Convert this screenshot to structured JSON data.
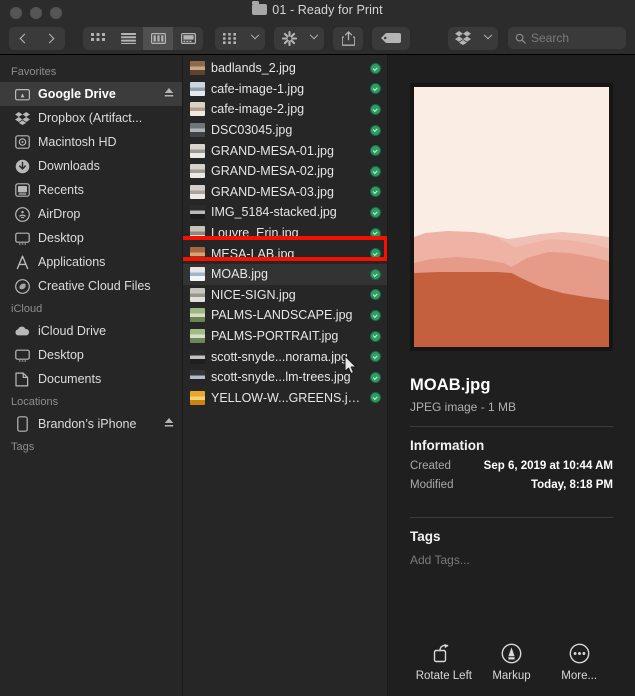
{
  "window": {
    "title": "01 - Ready for Print",
    "title_icon": "folder-icon",
    "traffic_lights": [
      "close-button",
      "minimize-button",
      "maximize-button"
    ]
  },
  "toolbar": {
    "back_icon": "chevron-left-icon",
    "forward_icon": "chevron-right-icon",
    "view_modes": [
      {
        "name": "icon-view",
        "icon": "grid-icon",
        "selected": false
      },
      {
        "name": "list-view",
        "icon": "list-icon",
        "selected": false
      },
      {
        "name": "column-view",
        "icon": "columns-icon",
        "selected": true
      },
      {
        "name": "gallery-view",
        "icon": "gallery-icon",
        "selected": false
      }
    ],
    "group_by_icon": "grid-group-icon",
    "action_icon": "gear-icon",
    "share_icon": "share-icon",
    "tag_icon": "tag-icon",
    "dropbox_icon": "dropbox-icon",
    "search": {
      "icon": "search-icon",
      "placeholder": "Search",
      "value": ""
    }
  },
  "sidebar": {
    "sections": [
      {
        "header": "Favorites",
        "items": [
          {
            "label": "Google Drive",
            "icon": "google-drive-icon",
            "selected": true,
            "eject": true
          },
          {
            "label": "Dropbox (Artifact...",
            "icon": "dropbox-icon",
            "selected": false,
            "eject": false
          },
          {
            "label": "Macintosh HD",
            "icon": "hard-drive-icon",
            "selected": false,
            "eject": false
          },
          {
            "label": "Downloads",
            "icon": "downloads-icon",
            "selected": false,
            "eject": false
          },
          {
            "label": "Recents",
            "icon": "recents-icon",
            "selected": false,
            "eject": false
          },
          {
            "label": "AirDrop",
            "icon": "airdrop-icon",
            "selected": false,
            "eject": false
          },
          {
            "label": "Desktop",
            "icon": "desktop-icon",
            "selected": false,
            "eject": false
          },
          {
            "label": "Applications",
            "icon": "applications-icon",
            "selected": false,
            "eject": false
          },
          {
            "label": "Creative Cloud Files",
            "icon": "creative-cloud-icon",
            "selected": false,
            "eject": false
          }
        ]
      },
      {
        "header": "iCloud",
        "items": [
          {
            "label": "iCloud Drive",
            "icon": "cloud-icon",
            "selected": false,
            "eject": false
          },
          {
            "label": "Desktop",
            "icon": "desktop-icon",
            "selected": false,
            "eject": false
          },
          {
            "label": "Documents",
            "icon": "documents-icon",
            "selected": false,
            "eject": false
          }
        ]
      },
      {
        "header": "Locations",
        "items": [
          {
            "label": "Brandon’s iPhone",
            "icon": "iphone-icon",
            "selected": false,
            "eject": true
          }
        ]
      },
      {
        "header": "Tags",
        "items": []
      }
    ]
  },
  "file_list": {
    "files": [
      {
        "name": "badlands_2.jpg",
        "selected": false,
        "synced": true,
        "thumb": [
          "#8a6b4e",
          "#c8a882",
          "#5e4430"
        ]
      },
      {
        "name": "cafe-image-1.jpg",
        "selected": false,
        "synced": true,
        "thumb": [
          "#cdd6de",
          "#8fa0b0",
          "#e6eaee"
        ]
      },
      {
        "name": "cafe-image-2.jpg",
        "selected": false,
        "synced": true,
        "thumb": [
          "#dcd2c4",
          "#b3a08a",
          "#efe9e0"
        ]
      },
      {
        "name": "DSC03045.jpg",
        "selected": false,
        "synced": true,
        "thumb": [
          "#6f7478",
          "#aeb4b8",
          "#3f4347"
        ]
      },
      {
        "name": "GRAND-MESA-01.jpg",
        "selected": false,
        "synced": true,
        "thumb": [
          "#d8d4cd",
          "#9e9a93",
          "#efece7"
        ]
      },
      {
        "name": "GRAND-MESA-02.jpg",
        "selected": false,
        "synced": true,
        "thumb": [
          "#d6d2cb",
          "#a09b94",
          "#edeae5"
        ]
      },
      {
        "name": "GRAND-MESA-03.jpg",
        "selected": false,
        "synced": true,
        "thumb": [
          "#d4d0c9",
          "#a8a29a",
          "#eceae4"
        ]
      },
      {
        "name": "IMG_5184-stacked.jpg",
        "selected": false,
        "synced": true,
        "thumb": [
          "#2b2b2b",
          "#b9b9b9",
          "#1c1c1c"
        ]
      },
      {
        "name": "Louvre_Erin.jpg",
        "selected": false,
        "synced": true,
        "thumb": [
          "#c7c3bb",
          "#8d8880",
          "#e2ded7"
        ]
      },
      {
        "name": "MESA-LAB.jpg",
        "selected": false,
        "synced": true,
        "thumb": [
          "#a9673f",
          "#d8a376",
          "#7a4527"
        ]
      },
      {
        "name": "MOAB.jpg",
        "selected": true,
        "synced": true,
        "thumb": [
          "#e8e8e8",
          "#9db6c9",
          "#f6f6f6"
        ]
      },
      {
        "name": "NICE-SIGN.jpg",
        "selected": false,
        "synced": true,
        "thumb": [
          "#c9c6c0",
          "#9a968f",
          "#e3e0da"
        ]
      },
      {
        "name": "PALMS-LANDSCAPE.jpg",
        "selected": false,
        "synced": true,
        "thumb": [
          "#9fb77f",
          "#d5ddc3",
          "#6d8354"
        ]
      },
      {
        "name": "PALMS-PORTRAIT.jpg",
        "selected": false,
        "synced": true,
        "thumb": [
          "#a2ba84",
          "#d8e0c8",
          "#70875a"
        ]
      },
      {
        "name": "scott-snyde...norama.jpg",
        "selected": false,
        "synced": true,
        "thumb": [
          "#2a2a2a",
          "#c3c3c3",
          "#1e1e1e"
        ]
      },
      {
        "name": "scott-snyde...lm-trees.jpg",
        "selected": false,
        "synced": true,
        "thumb": [
          "#33363a",
          "#b6bcc2",
          "#22252a"
        ]
      },
      {
        "name": "YELLOW-W...GREENS.jpg",
        "selected": false,
        "synced": true,
        "thumb": [
          "#e8a62a",
          "#f5d074",
          "#c98411"
        ]
      }
    ],
    "annotation": {
      "type": "red-highlight-box",
      "target": "MOAB.jpg",
      "color": "#f51000"
    },
    "cursor": {
      "name": "mouse-pointer",
      "near": "YELLOW-W...GREENS.jpg"
    }
  },
  "preview": {
    "image_alt": "moab-desert-mesa-preview",
    "file_name": "MOAB.jpg",
    "kind_and_size": "JPEG image - 1 MB",
    "information_heading": "Information",
    "info_rows": [
      {
        "key": "Created",
        "value": "Sep 6, 2019 at 10:44 AM"
      },
      {
        "key": "Modified",
        "value": "Today, 8:18 PM"
      }
    ],
    "tags_heading": "Tags",
    "add_tags_placeholder": "Add Tags...",
    "actions": [
      {
        "label": "Rotate Left",
        "icon": "rotate-left-icon"
      },
      {
        "label": "Markup",
        "icon": "markup-icon"
      },
      {
        "label": "More...",
        "icon": "more-icon"
      }
    ],
    "image_palette": {
      "sky": "#faeee4",
      "far_mesa": "#eeb9ad",
      "mid_mesa": "#e8a596",
      "near_mesa": "#d8836e",
      "foreground": "#c35a3c"
    }
  }
}
